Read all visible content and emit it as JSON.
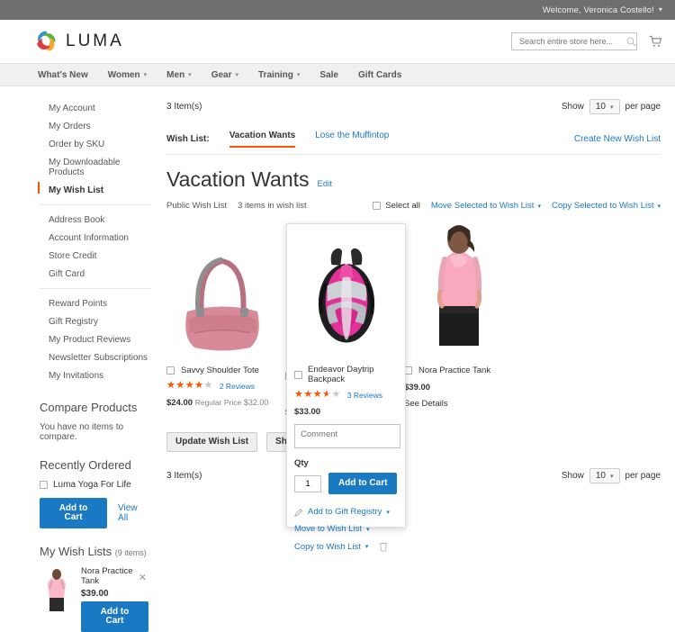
{
  "topbar": {
    "welcome": "Welcome, Veronica Costello!",
    "caret": "chevron-down-icon"
  },
  "header": {
    "logo_text": "LUMA",
    "search_placeholder": "Search entire store here...",
    "search_value": "",
    "cart_icon": "cart-icon",
    "search_icon": "search-icon"
  },
  "nav": {
    "items": [
      {
        "label": "What's New",
        "has_caret": false
      },
      {
        "label": "Women",
        "has_caret": true
      },
      {
        "label": "Men",
        "has_caret": true
      },
      {
        "label": "Gear",
        "has_caret": true
      },
      {
        "label": "Training",
        "has_caret": true
      },
      {
        "label": "Sale",
        "has_caret": false
      },
      {
        "label": "Gift Cards",
        "has_caret": false
      }
    ]
  },
  "sidebar": {
    "nav_group_1": [
      {
        "label": "My Account",
        "current": false
      },
      {
        "label": "My Orders",
        "current": false
      },
      {
        "label": "Order by SKU",
        "current": false
      },
      {
        "label": "My Downloadable Products",
        "current": false
      },
      {
        "label": "My Wish List",
        "current": true
      }
    ],
    "nav_group_2": [
      {
        "label": "Address Book"
      },
      {
        "label": "Account Information"
      },
      {
        "label": "Store Credit"
      },
      {
        "label": "Gift Card"
      }
    ],
    "nav_group_3": [
      {
        "label": "Reward Points"
      },
      {
        "label": "Gift Registry"
      },
      {
        "label": "My Product Reviews"
      },
      {
        "label": "Newsletter Subscriptions"
      },
      {
        "label": "My Invitations"
      }
    ],
    "compare": {
      "title": "Compare Products",
      "empty_text": "You have no items to compare."
    },
    "recently_ordered": {
      "title": "Recently Ordered",
      "item_label": "Luma Yoga For Life",
      "add_to_cart": "Add to Cart",
      "view_all": "View All"
    },
    "my_wish_lists": {
      "title": "My Wish Lists",
      "count": "(9 items)",
      "item_name": "Nora Practice Tank",
      "item_price": "$39.00",
      "add_to_cart": "Add to Cart",
      "remove_icon": "close-icon"
    }
  },
  "main": {
    "toolbar_top": {
      "count": "3 Item(s)",
      "show_label": "Show",
      "limit_value": "10",
      "per_page_label": "per page"
    },
    "wishlist_tabs": {
      "label": "Wish List:",
      "tabs": [
        {
          "label": "Vacation Wants",
          "active": true
        },
        {
          "label": "Lose the Muffintop",
          "active": false
        }
      ],
      "create_link": "Create New Wish List"
    },
    "title": "Vacation Wants",
    "edit_link": "Edit",
    "subbar": {
      "visibility": "Public Wish List",
      "item_count": "3 items in wish list",
      "select_all": "Select all",
      "move_selected": "Move Selected to Wish List",
      "copy_selected": "Copy Selected to Wish List"
    },
    "products": [
      {
        "name": "Savvy Shoulder Tote",
        "rating_percent": 80,
        "reviews": "2 Reviews",
        "price": "$24.00",
        "regular_price_label": "Regular Price",
        "regular_price": "$32.00",
        "image": "pink-shoulder-tote"
      },
      {
        "name": "Endeavor Daytrip Backpack",
        "rating_percent": 72,
        "reviews": "3 Reviews",
        "price": "$33.00",
        "image": "pink-black-backpack"
      },
      {
        "name": "Nora Practice Tank",
        "price": "$39.00",
        "see_details": "See Details",
        "image": "pink-tank-model"
      }
    ],
    "bottom_actions": {
      "update": "Update Wish List",
      "share": "Share W"
    },
    "toolbar_bottom": {
      "count": "3 Item(s)",
      "show_label": "Show",
      "limit_value": "10",
      "per_page_label": "per page"
    }
  },
  "hover_card": {
    "name": "Endeavor Daytrip Backpack",
    "comment_placeholder": "Comment",
    "comment_value": "",
    "qty_label": "Qty",
    "qty_value": "1",
    "add_to_cart": "Add to Cart",
    "gift_registry": "Add to Gift Registry",
    "move_to_wishlist": "Move to Wish List",
    "copy_to_wishlist": "Copy to Wish List",
    "delete_icon": "trash-icon",
    "pencil_icon": "pencil-icon"
  },
  "colors": {
    "accent_orange": "#ff5501",
    "link_blue": "#1979c3",
    "topbar_gray": "#6e6e6e",
    "nav_gray": "#f0f0f0"
  }
}
